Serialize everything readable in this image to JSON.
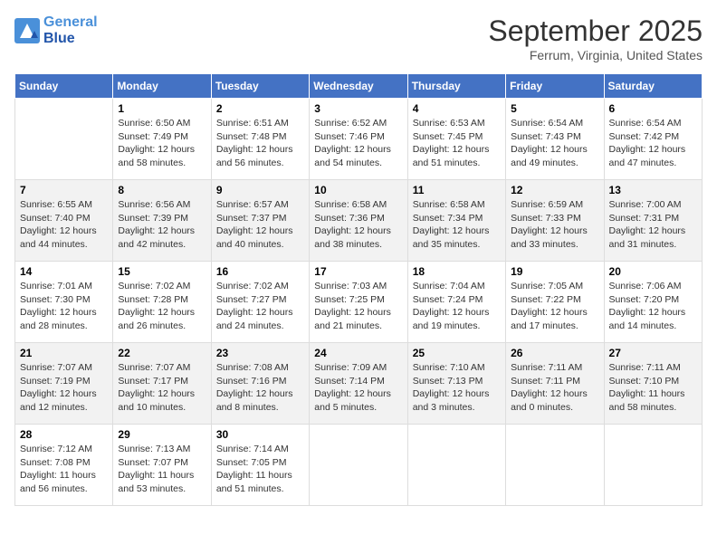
{
  "header": {
    "logo_line1": "General",
    "logo_line2": "Blue",
    "month_title": "September 2025",
    "subtitle": "Ferrum, Virginia, United States"
  },
  "weekdays": [
    "Sunday",
    "Monday",
    "Tuesday",
    "Wednesday",
    "Thursday",
    "Friday",
    "Saturday"
  ],
  "weeks": [
    [
      {
        "day": "",
        "info": ""
      },
      {
        "day": "1",
        "info": "Sunrise: 6:50 AM\nSunset: 7:49 PM\nDaylight: 12 hours\nand 58 minutes."
      },
      {
        "day": "2",
        "info": "Sunrise: 6:51 AM\nSunset: 7:48 PM\nDaylight: 12 hours\nand 56 minutes."
      },
      {
        "day": "3",
        "info": "Sunrise: 6:52 AM\nSunset: 7:46 PM\nDaylight: 12 hours\nand 54 minutes."
      },
      {
        "day": "4",
        "info": "Sunrise: 6:53 AM\nSunset: 7:45 PM\nDaylight: 12 hours\nand 51 minutes."
      },
      {
        "day": "5",
        "info": "Sunrise: 6:54 AM\nSunset: 7:43 PM\nDaylight: 12 hours\nand 49 minutes."
      },
      {
        "day": "6",
        "info": "Sunrise: 6:54 AM\nSunset: 7:42 PM\nDaylight: 12 hours\nand 47 minutes."
      }
    ],
    [
      {
        "day": "7",
        "info": "Sunrise: 6:55 AM\nSunset: 7:40 PM\nDaylight: 12 hours\nand 44 minutes."
      },
      {
        "day": "8",
        "info": "Sunrise: 6:56 AM\nSunset: 7:39 PM\nDaylight: 12 hours\nand 42 minutes."
      },
      {
        "day": "9",
        "info": "Sunrise: 6:57 AM\nSunset: 7:37 PM\nDaylight: 12 hours\nand 40 minutes."
      },
      {
        "day": "10",
        "info": "Sunrise: 6:58 AM\nSunset: 7:36 PM\nDaylight: 12 hours\nand 38 minutes."
      },
      {
        "day": "11",
        "info": "Sunrise: 6:58 AM\nSunset: 7:34 PM\nDaylight: 12 hours\nand 35 minutes."
      },
      {
        "day": "12",
        "info": "Sunrise: 6:59 AM\nSunset: 7:33 PM\nDaylight: 12 hours\nand 33 minutes."
      },
      {
        "day": "13",
        "info": "Sunrise: 7:00 AM\nSunset: 7:31 PM\nDaylight: 12 hours\nand 31 minutes."
      }
    ],
    [
      {
        "day": "14",
        "info": "Sunrise: 7:01 AM\nSunset: 7:30 PM\nDaylight: 12 hours\nand 28 minutes."
      },
      {
        "day": "15",
        "info": "Sunrise: 7:02 AM\nSunset: 7:28 PM\nDaylight: 12 hours\nand 26 minutes."
      },
      {
        "day": "16",
        "info": "Sunrise: 7:02 AM\nSunset: 7:27 PM\nDaylight: 12 hours\nand 24 minutes."
      },
      {
        "day": "17",
        "info": "Sunrise: 7:03 AM\nSunset: 7:25 PM\nDaylight: 12 hours\nand 21 minutes."
      },
      {
        "day": "18",
        "info": "Sunrise: 7:04 AM\nSunset: 7:24 PM\nDaylight: 12 hours\nand 19 minutes."
      },
      {
        "day": "19",
        "info": "Sunrise: 7:05 AM\nSunset: 7:22 PM\nDaylight: 12 hours\nand 17 minutes."
      },
      {
        "day": "20",
        "info": "Sunrise: 7:06 AM\nSunset: 7:20 PM\nDaylight: 12 hours\nand 14 minutes."
      }
    ],
    [
      {
        "day": "21",
        "info": "Sunrise: 7:07 AM\nSunset: 7:19 PM\nDaylight: 12 hours\nand 12 minutes."
      },
      {
        "day": "22",
        "info": "Sunrise: 7:07 AM\nSunset: 7:17 PM\nDaylight: 12 hours\nand 10 minutes."
      },
      {
        "day": "23",
        "info": "Sunrise: 7:08 AM\nSunset: 7:16 PM\nDaylight: 12 hours\nand 8 minutes."
      },
      {
        "day": "24",
        "info": "Sunrise: 7:09 AM\nSunset: 7:14 PM\nDaylight: 12 hours\nand 5 minutes."
      },
      {
        "day": "25",
        "info": "Sunrise: 7:10 AM\nSunset: 7:13 PM\nDaylight: 12 hours\nand 3 minutes."
      },
      {
        "day": "26",
        "info": "Sunrise: 7:11 AM\nSunset: 7:11 PM\nDaylight: 12 hours\nand 0 minutes."
      },
      {
        "day": "27",
        "info": "Sunrise: 7:11 AM\nSunset: 7:10 PM\nDaylight: 11 hours\nand 58 minutes."
      }
    ],
    [
      {
        "day": "28",
        "info": "Sunrise: 7:12 AM\nSunset: 7:08 PM\nDaylight: 11 hours\nand 56 minutes."
      },
      {
        "day": "29",
        "info": "Sunrise: 7:13 AM\nSunset: 7:07 PM\nDaylight: 11 hours\nand 53 minutes."
      },
      {
        "day": "30",
        "info": "Sunrise: 7:14 AM\nSunset: 7:05 PM\nDaylight: 11 hours\nand 51 minutes."
      },
      {
        "day": "",
        "info": ""
      },
      {
        "day": "",
        "info": ""
      },
      {
        "day": "",
        "info": ""
      },
      {
        "day": "",
        "info": ""
      }
    ]
  ]
}
